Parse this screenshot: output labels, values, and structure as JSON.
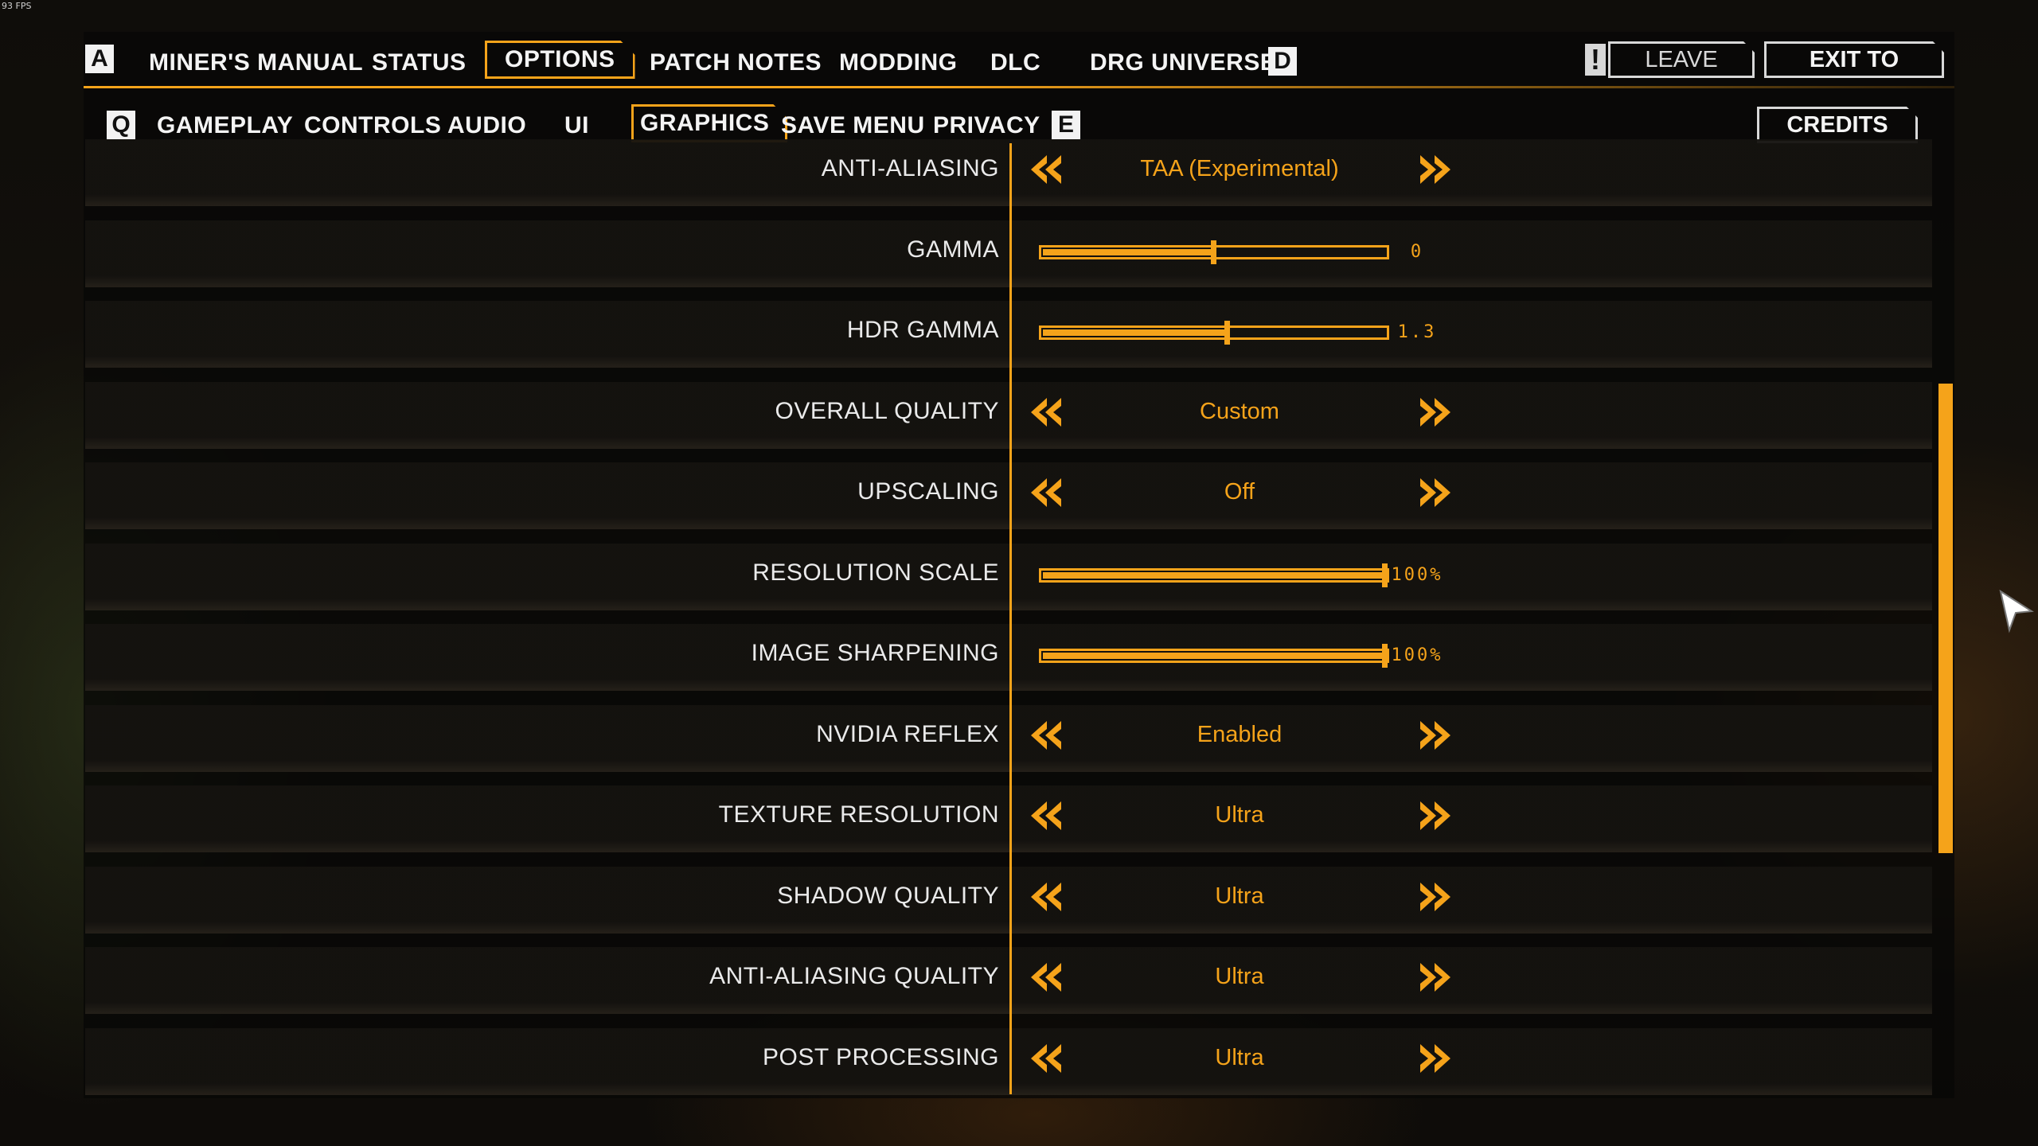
{
  "fps": "93 FPS",
  "topnav": {
    "left_key": "A",
    "right_key": "D",
    "items": [
      {
        "label": "MINER'S MANUAL"
      },
      {
        "label": "STATUS"
      },
      {
        "label": "OPTIONS"
      },
      {
        "label": "PATCH NOTES"
      },
      {
        "label": "MODDING"
      },
      {
        "label": "DLC"
      },
      {
        "label": "DRG UNIVERSE"
      }
    ],
    "active": "OPTIONS",
    "leave_team": "LEAVE TEAM",
    "exit_desktop": "EXIT TO DESKTOP"
  },
  "subnav": {
    "left_key": "Q",
    "right_key": "E",
    "items": [
      {
        "label": "GAMEPLAY"
      },
      {
        "label": "CONTROLS"
      },
      {
        "label": "AUDIO"
      },
      {
        "label": "UI"
      },
      {
        "label": "GRAPHICS"
      },
      {
        "label": "SAVE MENU"
      },
      {
        "label": "PRIVACY"
      }
    ],
    "active": "GRAPHICS",
    "credits": "CREDITS"
  },
  "settings": [
    {
      "label": "ANTI-ALIASING",
      "type": "select",
      "value": "TAA (Experimental)"
    },
    {
      "label": "GAMMA",
      "type": "slider",
      "display": "0",
      "level": 0.5
    },
    {
      "label": "HDR GAMMA",
      "type": "slider",
      "display": "1.3",
      "level": 0.54
    },
    {
      "label": "OVERALL QUALITY",
      "type": "select",
      "value": "Custom"
    },
    {
      "label": "UPSCALING",
      "type": "select",
      "value": "Off"
    },
    {
      "label": "RESOLUTION SCALE",
      "type": "slider",
      "display": "100%",
      "level": 1.0
    },
    {
      "label": "IMAGE SHARPENING",
      "type": "slider",
      "display": "100%",
      "level": 1.0
    },
    {
      "label": "NVIDIA REFLEX",
      "type": "select",
      "value": "Enabled"
    },
    {
      "label": "TEXTURE RESOLUTION",
      "type": "select",
      "value": "Ultra"
    },
    {
      "label": "SHADOW QUALITY",
      "type": "select",
      "value": "Ultra"
    },
    {
      "label": "ANTI-ALIASING QUALITY",
      "type": "select",
      "value": "Ultra"
    },
    {
      "label": "POST PROCESSING",
      "type": "select",
      "value": "Ultra"
    }
  ],
  "colors": {
    "accent": "#f5a31a",
    "text": "#eaeaea"
  }
}
